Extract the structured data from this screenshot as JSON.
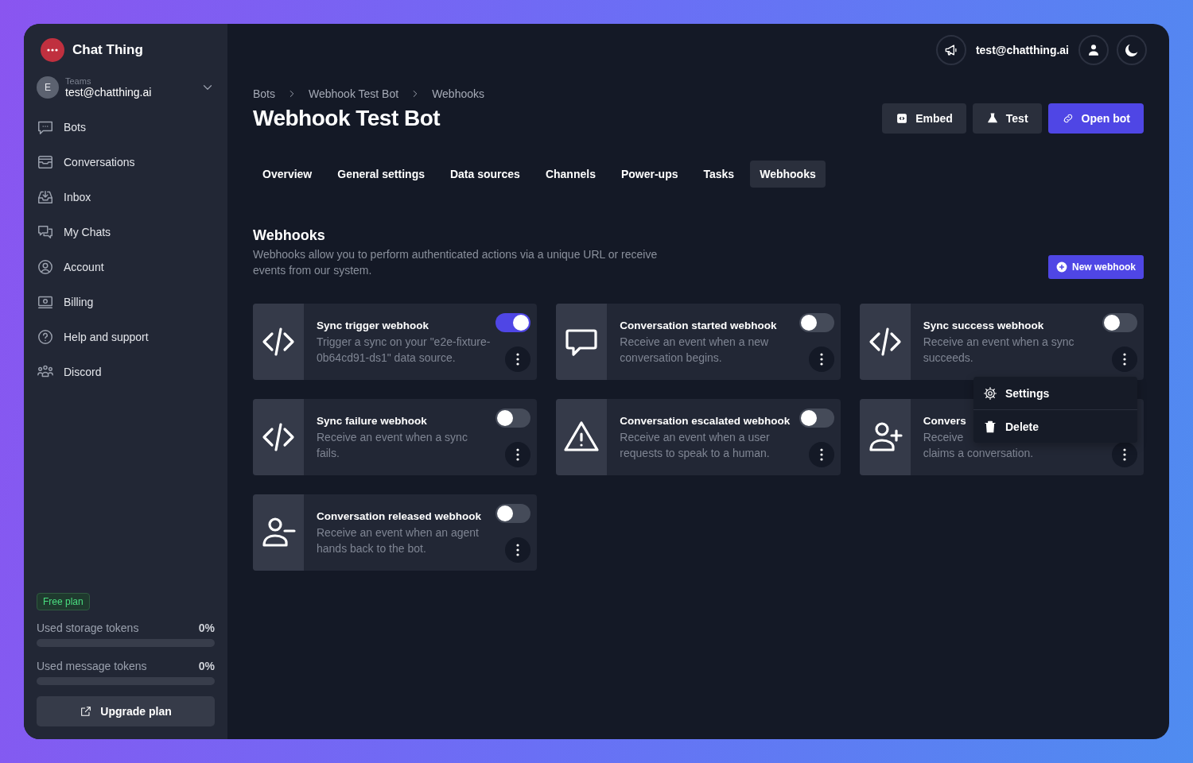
{
  "app": {
    "name": "Chat Thing"
  },
  "team": {
    "initial": "E",
    "label": "Teams",
    "email": "test@chatthing.ai"
  },
  "sidebar": {
    "items": [
      {
        "label": "Bots"
      },
      {
        "label": "Conversations"
      },
      {
        "label": "Inbox"
      },
      {
        "label": "My Chats"
      },
      {
        "label": "Account"
      },
      {
        "label": "Billing"
      },
      {
        "label": "Help and support"
      },
      {
        "label": "Discord"
      }
    ]
  },
  "plan": {
    "badge": "Free plan",
    "usage": [
      {
        "label": "Used storage tokens",
        "reading": "0%",
        "level": 0
      },
      {
        "label": "Used message tokens",
        "reading": "0%",
        "level": 0
      }
    ],
    "upgrade": "Upgrade plan"
  },
  "topbar": {
    "email": "test@chatthing.ai"
  },
  "breadcrumb": [
    "Bots",
    "Webhook Test Bot",
    "Webhooks"
  ],
  "title": "Webhook Test Bot",
  "actions": [
    {
      "label": "Embed",
      "kind": "secondary"
    },
    {
      "label": "Test",
      "kind": "secondary"
    },
    {
      "label": "Open bot",
      "kind": "primary"
    }
  ],
  "tabs": [
    {
      "label": "Overview",
      "selected": false
    },
    {
      "label": "General settings",
      "selected": false
    },
    {
      "label": "Data sources",
      "selected": false
    },
    {
      "label": "Channels",
      "selected": false
    },
    {
      "label": "Power-ups",
      "selected": false
    },
    {
      "label": "Tasks",
      "selected": false
    },
    {
      "label": "Webhooks",
      "selected": true
    }
  ],
  "section": {
    "title": "Webhooks",
    "description": "Webhooks allow you to perform authenticated actions via a unique URL or receive events from our system.",
    "new_button": "New webhook"
  },
  "webhooks": [
    {
      "title": "Sync trigger webhook",
      "description": "Trigger a sync on your \"e2e-fixture-0b64cd91-ds1\" data source.",
      "on": true
    },
    {
      "title": "Conversation started webhook",
      "description": "Receive an event when a new conversation begins.",
      "on": false
    },
    {
      "title": "Sync success webhook",
      "description": "Receive an event when a sync succeeds.",
      "on": false
    },
    {
      "title": "Sync failure webhook",
      "description": "Receive an event when a sync fails.",
      "on": false
    },
    {
      "title": "Conversation escalated webhook",
      "description": "Receive an event when a user requests to speak to a human.",
      "on": false
    },
    {
      "kind": "covered",
      "title": "Convers",
      "description_lines": [
        "Receive",
        "claims a conversation."
      ]
    },
    {
      "title": "Conversation released webhook",
      "description": "Receive an event when an agent hands back to the bot.",
      "on": false
    }
  ],
  "menu": {
    "items": [
      "Settings",
      "Delete"
    ]
  }
}
